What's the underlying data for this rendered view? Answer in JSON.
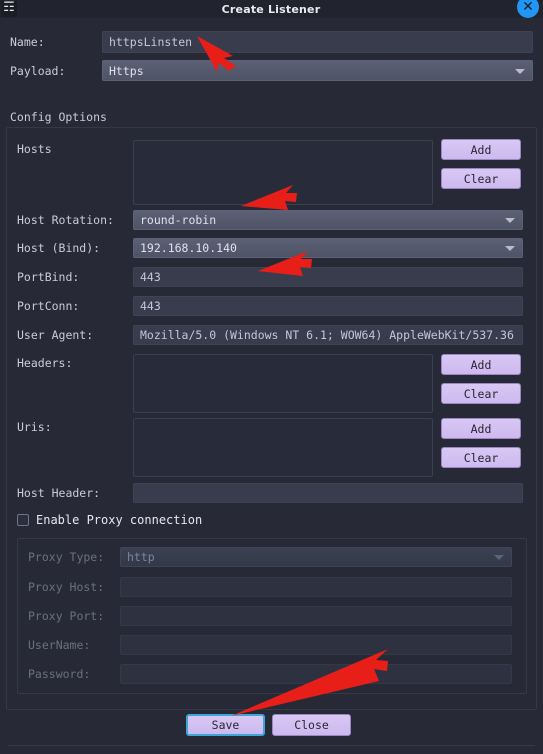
{
  "window": {
    "title": "Create Listener",
    "app_icon": "app-figure-icon",
    "close_icon": "close-icon"
  },
  "top_form": {
    "name_label": "Name:",
    "name_value": "httpsLinsten",
    "payload_label": "Payload:",
    "payload_value": "Https"
  },
  "config": {
    "group_title": "Config Options",
    "hosts_label": "Hosts",
    "hosts_items": [],
    "hosts_add_label": "Add",
    "hosts_clear_label": "Clear",
    "host_rotation_label": "Host Rotation:",
    "host_rotation_value": "round-robin",
    "host_bind_label": "Host (Bind):",
    "host_bind_value": "192.168.10.140",
    "portbind_label": "PortBind:",
    "portbind_value": "443",
    "portconn_label": "PortConn:",
    "portconn_value": "443",
    "user_agent_label": "User Agent:",
    "user_agent_value": "Mozilla/5.0 (Windows NT 6.1; WOW64) AppleWebKit/537.36",
    "headers_label": "Headers:",
    "headers_items": [],
    "headers_add_label": "Add",
    "headers_clear_label": "Clear",
    "uris_label": "Uris:",
    "uris_items": [],
    "uris_add_label": "Add",
    "uris_clear_label": "Clear",
    "host_header_label": "Host Header:",
    "host_header_value": ""
  },
  "proxy": {
    "enable_label": "Enable Proxy connection",
    "enable_checked": false,
    "type_label": "Proxy Type:",
    "type_value": "http",
    "host_label": "Proxy Host:",
    "host_value": "",
    "port_label": "Proxy Port:",
    "port_value": "",
    "username_label": "UserName:",
    "username_value": "",
    "password_label": "Password:",
    "password_value": ""
  },
  "footer": {
    "save_label": "Save",
    "close_label": "Close"
  },
  "colors": {
    "window_bg": "#272a36",
    "titlebar_bg": "#21242e",
    "field_bg": "#383c4d",
    "combo_bg": "#5b6074",
    "button_bg": "#d3c2f1",
    "accent_close": "#2196f3",
    "focus_ring": "#3aa7d8",
    "annotation_arrow": "#e81f18"
  }
}
